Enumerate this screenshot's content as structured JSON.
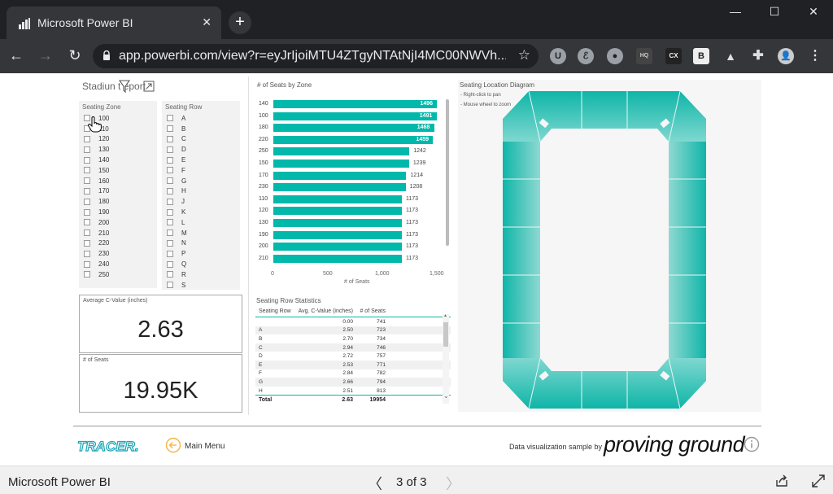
{
  "browser": {
    "tab_title": "Microsoft Power BI",
    "tab_close": "✕",
    "new_tab": "+",
    "url": "app.powerbi.com/view?r=eyJrIjoiMTU4ZTgyNTAtNjI4MC00NWVh...",
    "window": {
      "minimize": "—",
      "maximize": "☐",
      "close": "✕"
    },
    "nav": {
      "back": "←",
      "forward": "→",
      "reload": "↻",
      "star": "☆"
    },
    "extensions": [
      "U",
      "ℰ",
      "●",
      "HQ",
      "CX",
      "B",
      "▲",
      "✚",
      "👤",
      "⋮"
    ]
  },
  "report": {
    "page_title": "Stadiun      t   eport",
    "slicer_zone": {
      "header": "Seating Zone",
      "items": [
        "100",
        "110",
        "120",
        "130",
        "140",
        "150",
        "160",
        "170",
        "180",
        "190",
        "200",
        "210",
        "220",
        "230",
        "240",
        "250"
      ]
    },
    "slicer_row": {
      "header": "Seating Row",
      "items": [
        "A",
        "B",
        "C",
        "D",
        "E",
        "F",
        "G",
        "H",
        "J",
        "K",
        "L",
        "M",
        "N",
        "P",
        "Q",
        "R",
        "S"
      ]
    },
    "kpi_cvalue": {
      "label": "Average C-Value (inches)",
      "value": "2.63"
    },
    "kpi_seats": {
      "label": "# of Seats",
      "value": "19.95K"
    },
    "bar_chart": {
      "title": "# of Seats by Zone",
      "x_title": "# of Seats",
      "ticks": [
        "0",
        "500",
        "1,000",
        "1,500"
      ]
    },
    "table": {
      "title": "Seating Row Statistics",
      "headers": [
        "Seating Row",
        "Avg. C-Value (inches)",
        "# of Seats"
      ],
      "rows": [
        [
          "",
          "0.00",
          "741"
        ],
        [
          "A",
          "2.50",
          "723"
        ],
        [
          "B",
          "2.70",
          "734"
        ],
        [
          "C",
          "2.94",
          "746"
        ],
        [
          "D",
          "2.72",
          "757"
        ],
        [
          "E",
          "2.53",
          "771"
        ],
        [
          "F",
          "2.84",
          "782"
        ],
        [
          "G",
          "2.66",
          "794"
        ],
        [
          "H",
          "2.51",
          "813"
        ]
      ],
      "total": [
        "Total",
        "2.63",
        "19954"
      ],
      "scroll_up": "▲",
      "scroll_down": "⌄"
    },
    "diagram": {
      "title": "Seating Location Diagram",
      "notes": [
        "- Right-click to pan",
        "- Mouse wheel to zoom"
      ]
    },
    "footer": {
      "logo_text": "TRACER.",
      "menu_label": "Main Menu",
      "credit": "Data visualization sample by",
      "brand": "proving ground"
    }
  },
  "pbi_bar": {
    "title": "Microsoft Power BI",
    "prev": "〈",
    "page_indicator": "3 of 3",
    "next": "〉"
  },
  "colors": {
    "accent": "#01b8aa",
    "chrome_dark": "#202124",
    "chrome_mid": "#35363a"
  },
  "chart_data": {
    "type": "bar",
    "title": "# of Seats by Zone",
    "xlabel": "# of Seats",
    "xlim": [
      0,
      1500
    ],
    "categories": [
      "140",
      "100",
      "180",
      "220",
      "250",
      "150",
      "170",
      "230",
      "110",
      "120",
      "130",
      "190",
      "200",
      "210"
    ],
    "values": [
      1496,
      1491,
      1468,
      1459,
      1242,
      1239,
      1214,
      1208,
      1173,
      1173,
      1173,
      1173,
      1173,
      1173
    ],
    "labels": [
      "1496",
      "1491",
      "1468",
      "1459",
      "1242",
      "1239",
      "1214",
      "1208",
      "1173",
      "1173",
      "1173",
      "1173",
      "1173",
      "1173"
    ]
  }
}
